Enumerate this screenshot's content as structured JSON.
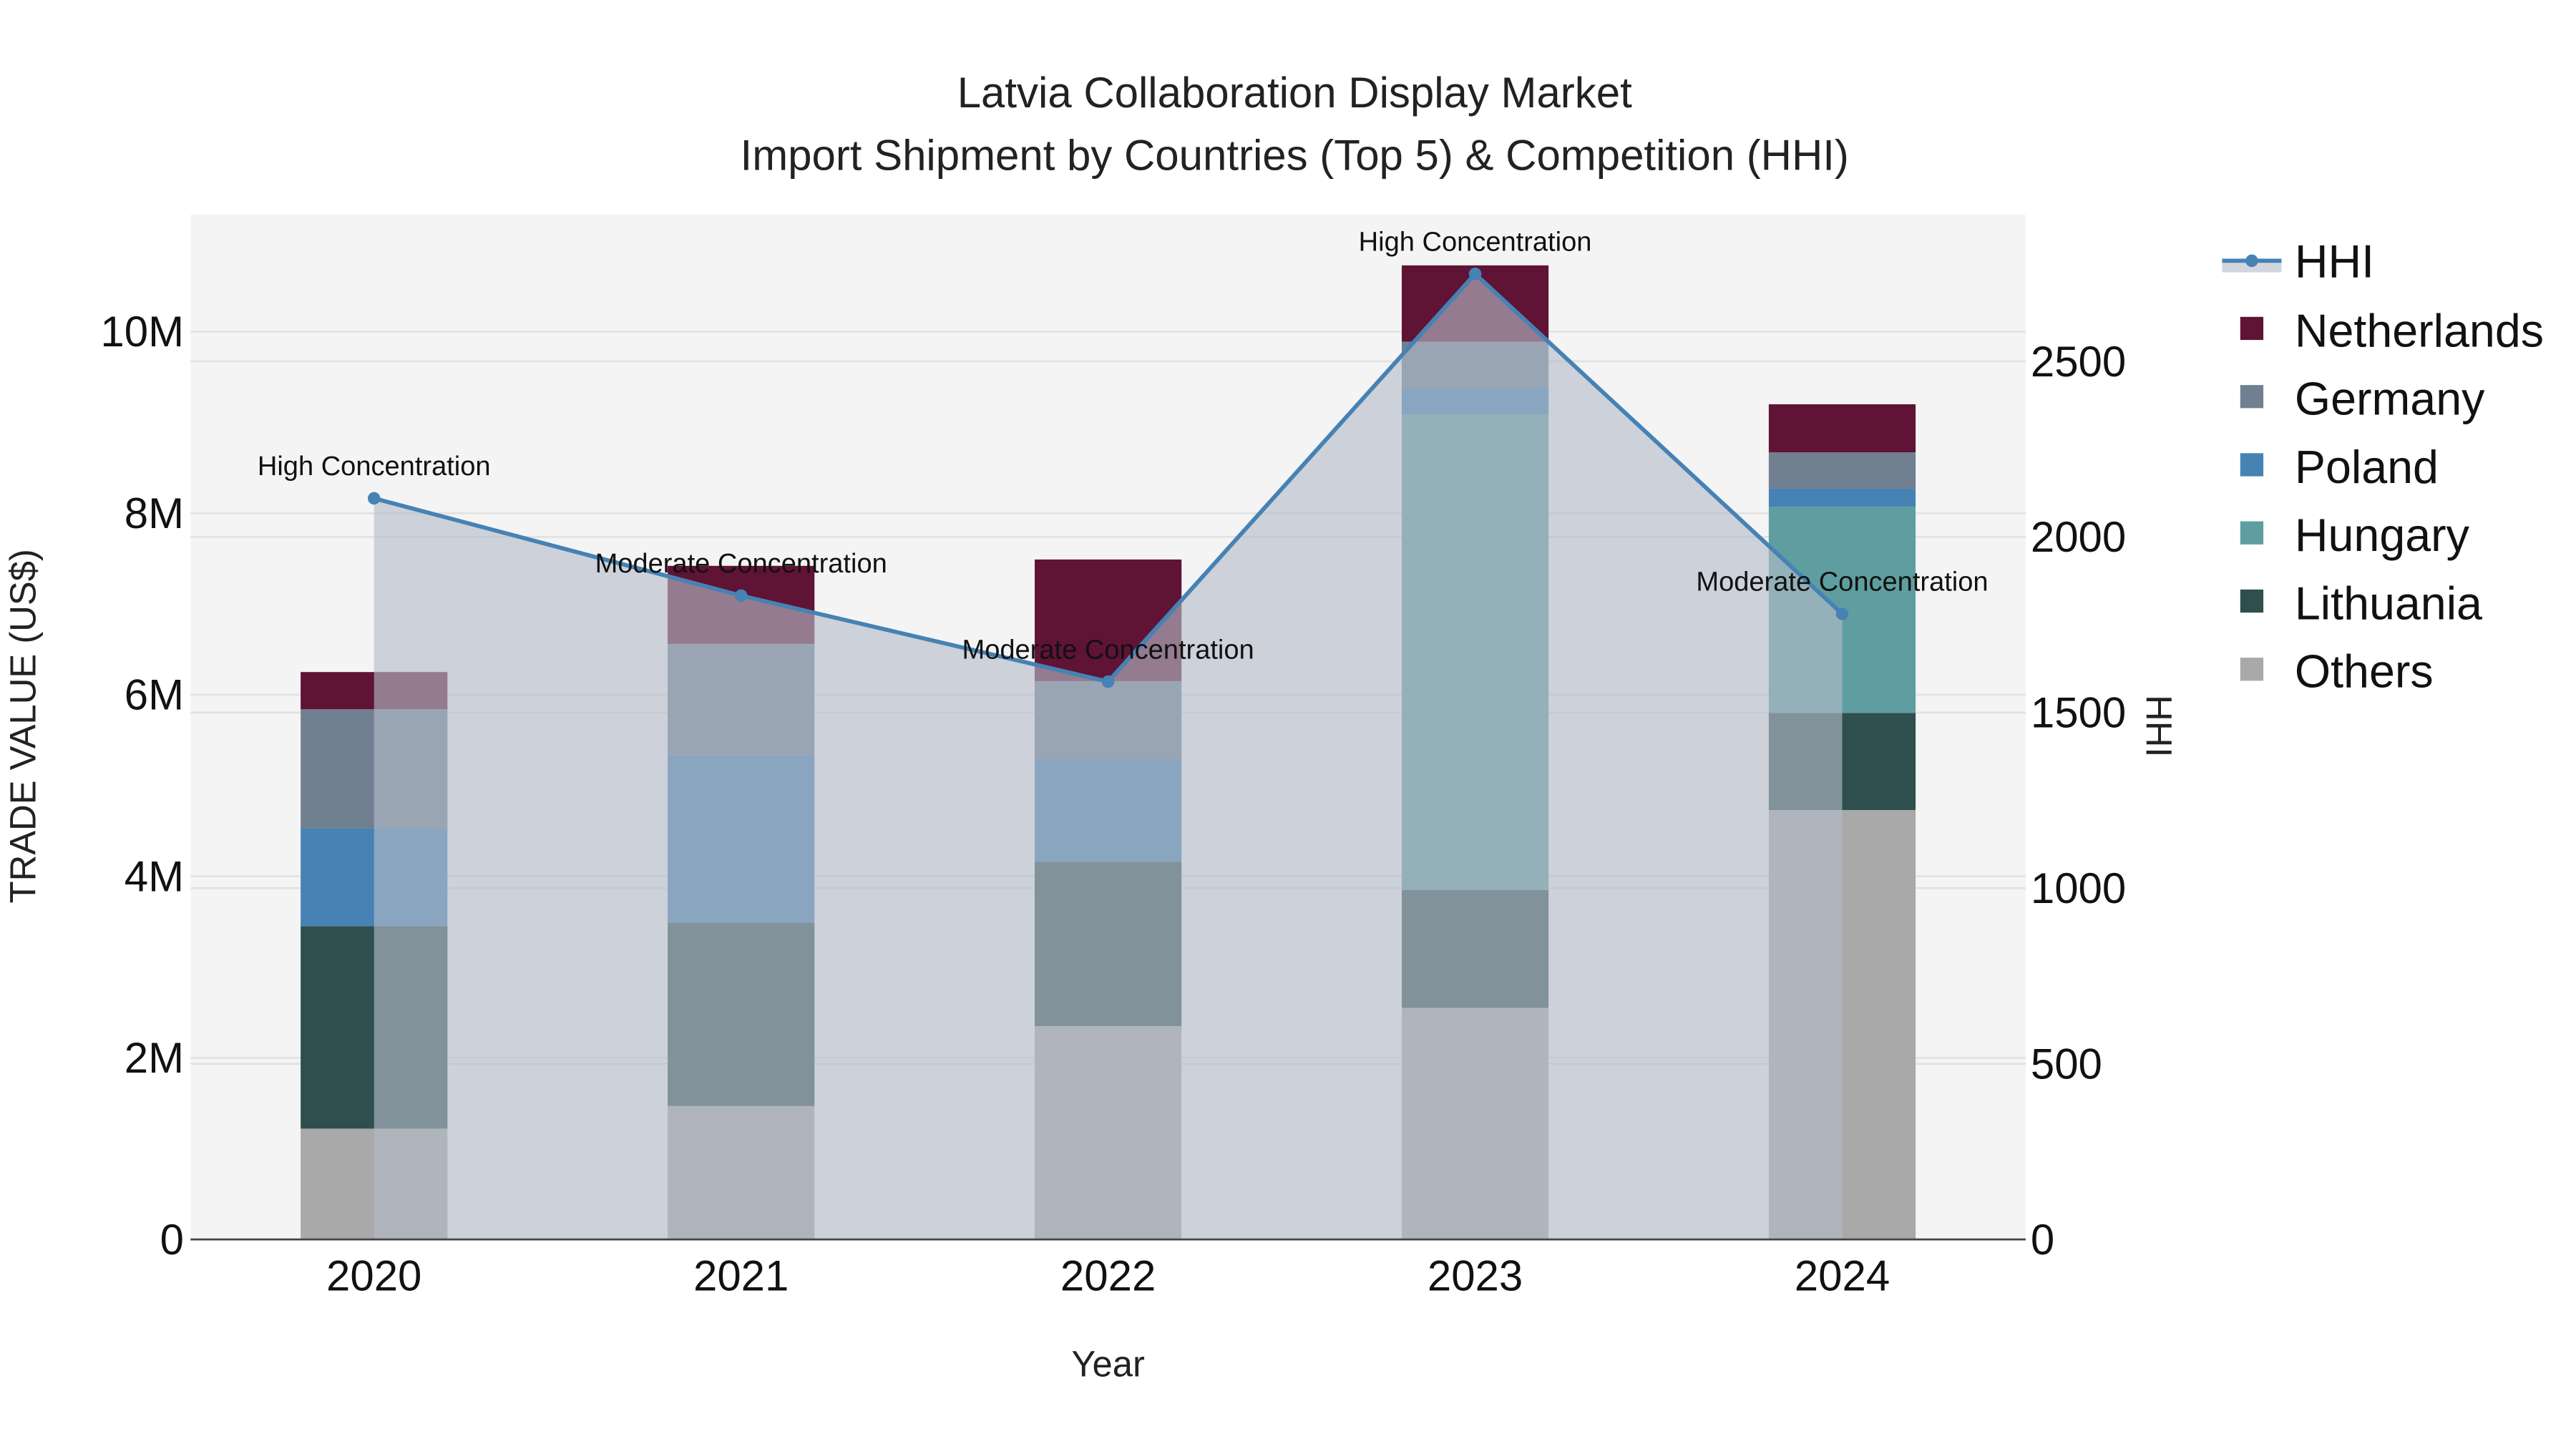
{
  "chart_data": {
    "type": "bar",
    "barmode": "stack",
    "title": "Latvia Collaboration Display Market",
    "subtitle": "Import Shipment by Countries (Top 5) & Competition (HHI)",
    "xlabel": "Year",
    "ylabel": "TRADE VALUE (US$)",
    "y2label": "HHI",
    "categories": [
      "2020",
      "2021",
      "2022",
      "2023",
      "2024"
    ],
    "ylim": [
      0,
      11290000
    ],
    "y2lim": [
      0,
      2918
    ],
    "yticks": [
      0,
      2000000,
      4000000,
      6000000,
      8000000,
      10000000
    ],
    "ytick_labels": [
      "0",
      "2M",
      "4M",
      "6M",
      "8M",
      "10M"
    ],
    "y2ticks": [
      0,
      500,
      1000,
      1500,
      2000,
      2500
    ],
    "y2tick_labels": [
      "0",
      "500",
      "1000",
      "1500",
      "2000",
      "2500"
    ],
    "grid": true,
    "legend_position": "right",
    "series": [
      {
        "name": "Others",
        "color": "#a9a9a9",
        "values": [
          1220000,
          1470000,
          2350000,
          2550000,
          4730000
        ]
      },
      {
        "name": "Lithuania",
        "color": "#2f4f4f",
        "values": [
          2230000,
          2020000,
          1810000,
          1300000,
          1070000
        ]
      },
      {
        "name": "Hungary",
        "color": "#5f9ea0",
        "values": [
          0,
          0,
          0,
          5240000,
          2270000
        ]
      },
      {
        "name": "Poland",
        "color": "#4682b4",
        "values": [
          1080000,
          1840000,
          1130000,
          290000,
          200000
        ]
      },
      {
        "name": "Germany",
        "color": "#708090",
        "values": [
          1310000,
          1230000,
          860000,
          510000,
          400000
        ]
      },
      {
        "name": "Netherlands",
        "color": "#5f1335",
        "values": [
          410000,
          860000,
          1340000,
          840000,
          530000
        ]
      }
    ],
    "line": {
      "name": "HHI",
      "color": "#4682b4",
      "axis": "y2",
      "values": [
        2110,
        1833,
        1588,
        2749,
        1781
      ],
      "annotations": [
        "High Concentration",
        "Moderate Concentration",
        "Moderate Concentration",
        "High Concentration",
        "Moderate Concentration"
      ]
    },
    "legend_order": [
      "HHI",
      "Netherlands",
      "Germany",
      "Poland",
      "Hungary",
      "Lithuania",
      "Others"
    ]
  }
}
